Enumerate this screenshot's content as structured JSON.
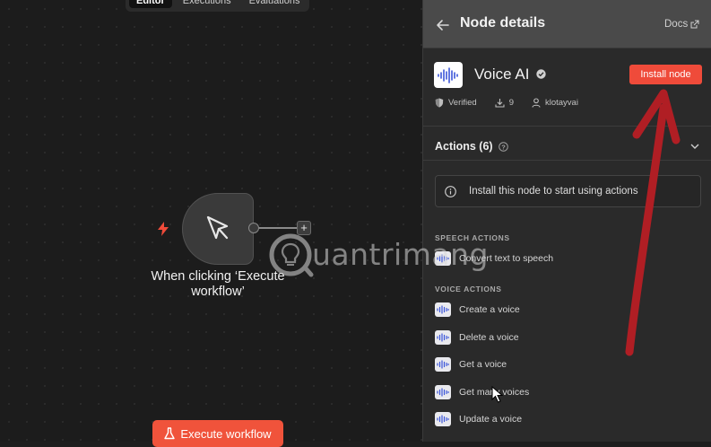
{
  "canvas": {
    "tabs": [
      {
        "label": "Editor",
        "active": true
      },
      {
        "label": "Executions",
        "active": false
      },
      {
        "label": "Evaluations",
        "active": false
      }
    ],
    "trigger_node": {
      "label": "When clicking ‘Execute workflow’",
      "icon": "cursor-icon"
    },
    "add_node": "+",
    "execute_button": {
      "label": "Execute workflow",
      "icon": "flask-icon"
    }
  },
  "watermark": {
    "text": "uantrimang"
  },
  "panel": {
    "title": "Node details",
    "docs_label": "Docs",
    "node": {
      "name": "Voice AI",
      "install_label": "Install node",
      "verified_label": "Verified",
      "downloads": "9",
      "author": "klotayvai"
    },
    "actions_label": "Actions (6)",
    "notice": "Install this node to start using actions",
    "sections": [
      {
        "label": "SPEECH ACTIONS",
        "items": [
          "Convert text to speech"
        ]
      },
      {
        "label": "VOICE ACTIONS",
        "items": [
          "Create a voice",
          "Delete a voice",
          "Get a voice",
          "Get many voices",
          "Update a voice"
        ]
      }
    ]
  },
  "colors": {
    "accent": "#ef4b3a",
    "annotation": "#b01e24",
    "background": "#1e1e1e",
    "panel": "#2a2a2a"
  }
}
